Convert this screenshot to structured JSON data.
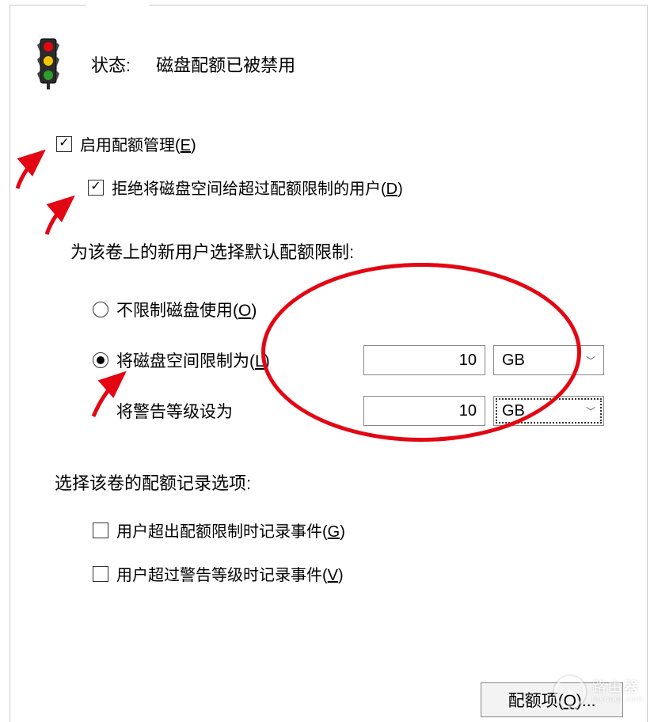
{
  "header": {
    "status_label": "状态:",
    "status_value": "磁盘配额已被禁用"
  },
  "checks": {
    "enable_quota": {
      "label": "启用配额管理(",
      "hotkey": "E",
      "suffix": ")",
      "checked": true
    },
    "deny_over": {
      "label": "拒绝将磁盘空间给超过配额限制的用户(",
      "hotkey": "D",
      "suffix": ")",
      "checked": true
    }
  },
  "default_limit_label": "为该卷上的新用户选择默认配额限制:",
  "radios": {
    "no_limit": {
      "label": "不限制磁盘使用(",
      "hotkey": "O",
      "suffix": ")",
      "selected": false
    },
    "set_limit": {
      "label": "将磁盘空间限制为(",
      "hotkey": "L",
      "suffix": ")",
      "selected": true
    }
  },
  "limit": {
    "label": "将磁盘空间限制为",
    "value": "10",
    "unit": "GB"
  },
  "warn": {
    "label": "将警告等级设为",
    "value": "10",
    "unit": "GB"
  },
  "log_label": "选择该卷的配额记录选项:",
  "log_checks": {
    "over_limit": {
      "label": "用户超出配额限制时记录事件(",
      "hotkey": "G",
      "suffix": ")",
      "checked": false
    },
    "over_warn": {
      "label": "用户超过警告等级时记录事件(",
      "hotkey": "V",
      "suffix": ")",
      "checked": false
    }
  },
  "quota_button": {
    "label": "配额项(",
    "hotkey": "Q",
    "suffix": ")..."
  },
  "watermark": {
    "cn": "路由器",
    "en": "luyouqi.com"
  }
}
